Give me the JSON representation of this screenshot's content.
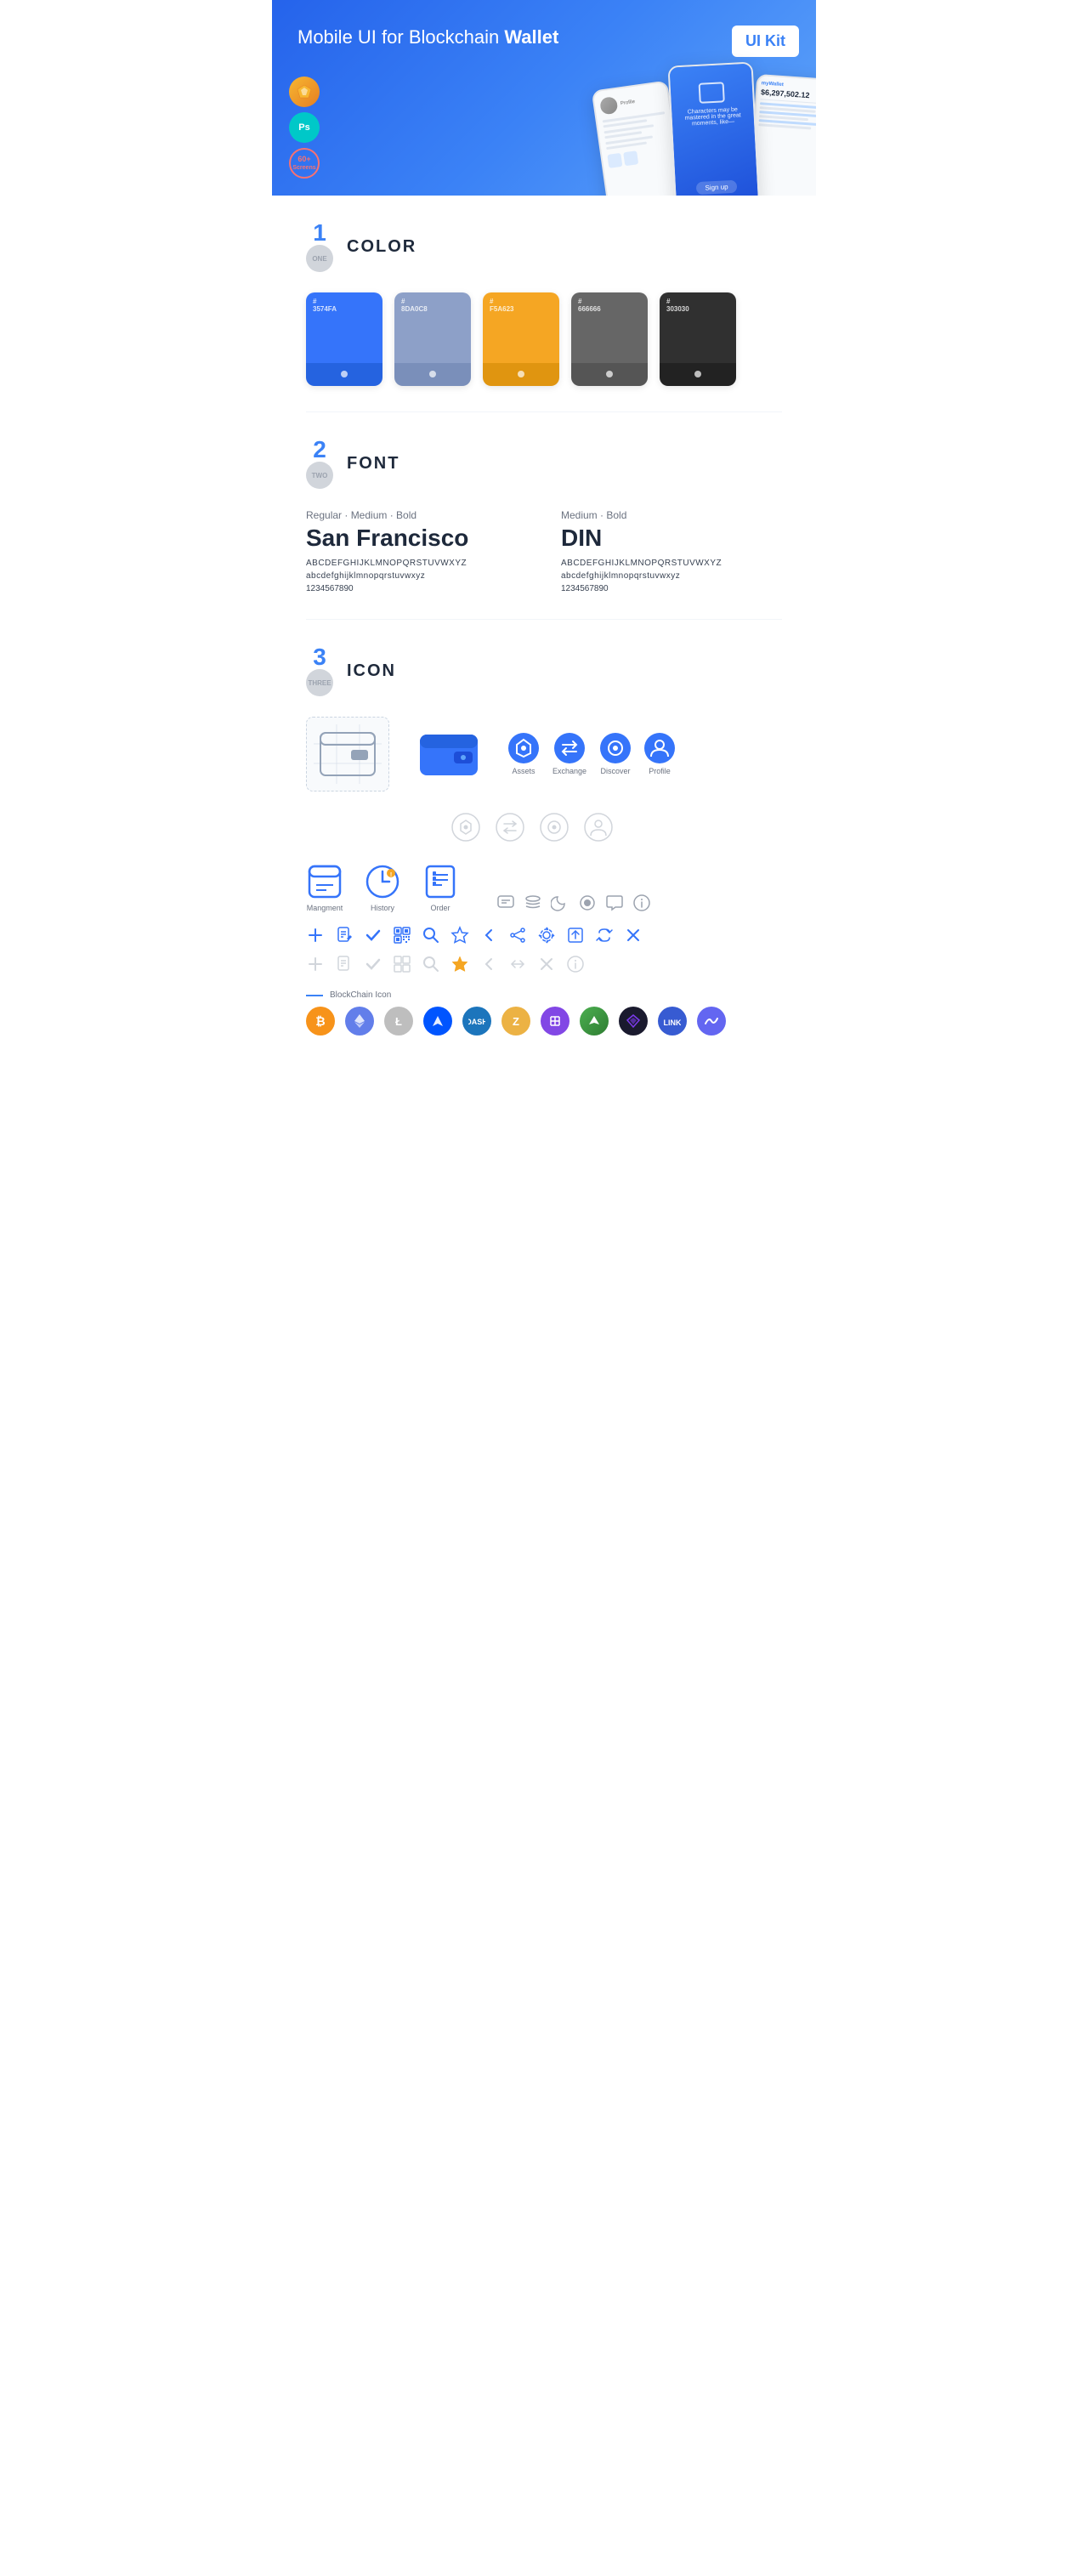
{
  "hero": {
    "title_regular": "Mobile UI for Blockchain ",
    "title_bold": "Wallet",
    "badge": "UI Kit",
    "badge_sketch": "S",
    "badge_ps": "Ps",
    "badge_60": "60+\nScreens"
  },
  "sections": {
    "color": {
      "number": "1",
      "label": "ONE",
      "title": "COLOR",
      "swatches": [
        {
          "hex": "#3574FA",
          "code": "#\n3574FA"
        },
        {
          "hex": "#8DA0C8",
          "code": "#\n8DA0C8"
        },
        {
          "hex": "#F5A623",
          "code": "#\nF5A623"
        },
        {
          "hex": "#666666",
          "code": "#\n666666"
        },
        {
          "hex": "#303030",
          "code": "#\n303030"
        }
      ]
    },
    "font": {
      "number": "2",
      "label": "TWO",
      "title": "FONT",
      "fonts": [
        {
          "style": "Regular · Medium · Bold",
          "name": "San Francisco",
          "upper": "ABCDEFGHIJKLMNOPQRSTUVWXYZ",
          "lower": "abcdefghijklmnopqrstuvwxyz",
          "numbers": "1234567890"
        },
        {
          "style": "Medium · Bold",
          "name": "DIN",
          "upper": "ABCDEFGHIJKLMNOPQRSTUVWXYZ",
          "lower": "abcdefghijklmnopqrstuvwxyz",
          "numbers": "1234567890"
        }
      ]
    },
    "icon": {
      "number": "3",
      "label": "THREE",
      "title": "ICON",
      "nav_icons": [
        {
          "label": "Assets"
        },
        {
          "label": "Exchange"
        },
        {
          "label": "Discover"
        },
        {
          "label": "Profile"
        }
      ],
      "app_icons": [
        {
          "label": "Mangment"
        },
        {
          "label": "History"
        },
        {
          "label": "Order"
        }
      ],
      "blockchain_label": "BlockChain Icon"
    }
  }
}
